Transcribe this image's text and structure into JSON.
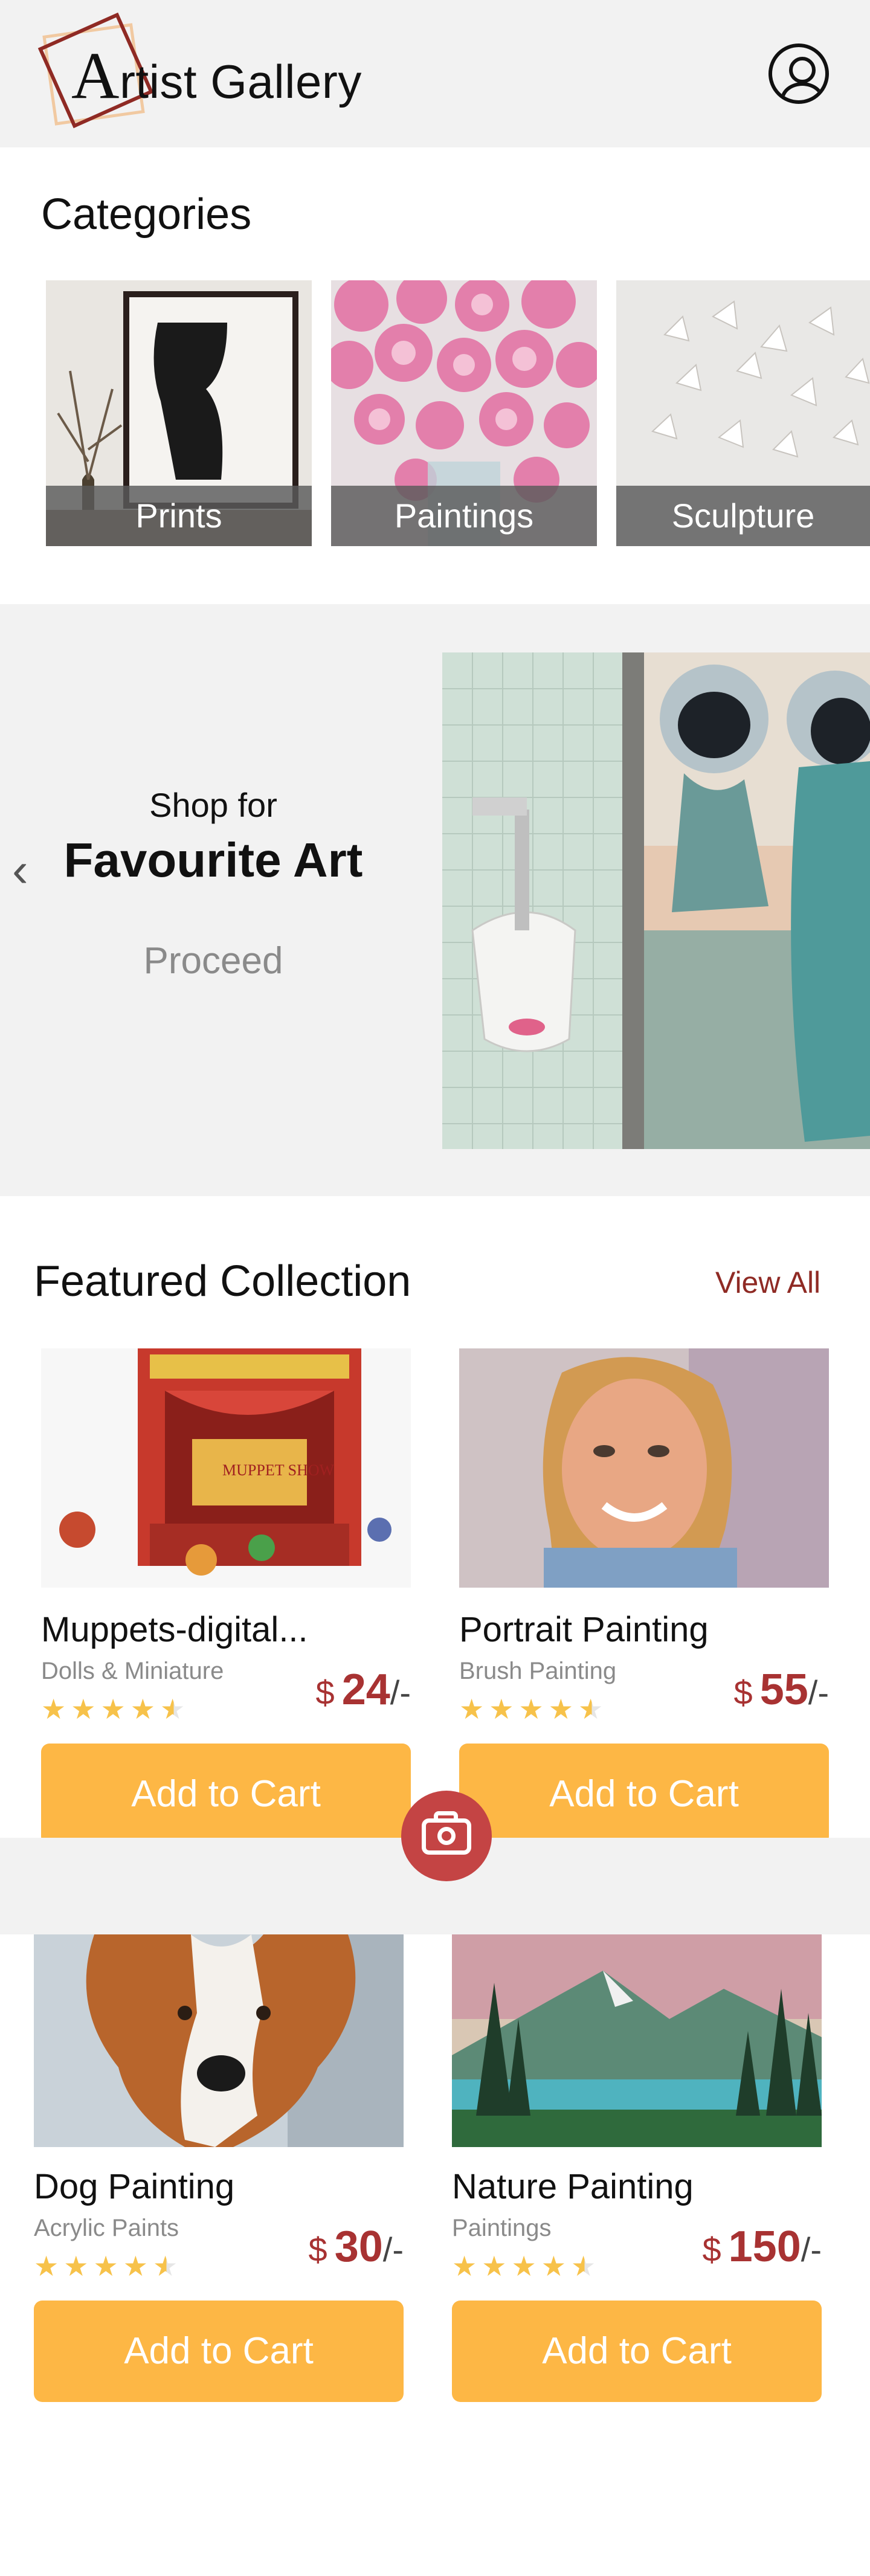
{
  "header": {
    "logo_initial": "A",
    "logo_rest": "rtist Gallery",
    "profile_icon": "user-circle-icon"
  },
  "categories": {
    "title": "Categories",
    "items": [
      {
        "label": "Prints"
      },
      {
        "label": "Paintings"
      },
      {
        "label": "Sculpture"
      }
    ]
  },
  "promo": {
    "prev_icon": "chevron-left-icon",
    "subtitle": "Shop for",
    "title": "Favourite Art",
    "cta": "Proceed"
  },
  "featured": {
    "title": "Featured Collection",
    "view_all": "View All",
    "products": [
      {
        "name": "Muppets-digital...",
        "category": "Dolls & Miniature",
        "currency": "$",
        "price": "24",
        "suffix": "/-",
        "rating": 4.5,
        "button": "Add to Cart"
      },
      {
        "name": "Portrait Painting",
        "category": "Brush Painting",
        "currency": "$",
        "price": "55",
        "suffix": "/-",
        "rating": 4.5,
        "button": "Add to Cart"
      },
      {
        "name": "Dog Painting",
        "category": "Acrylic Paints",
        "currency": "$",
        "price": "30",
        "suffix": "/-",
        "rating": 4.5,
        "button": "Add to Cart"
      },
      {
        "name": "Nature Painting",
        "category": "Paintings",
        "currency": "$",
        "price": "150",
        "suffix": "/-",
        "rating": 4.5,
        "button": "Add to Cart"
      }
    ]
  },
  "floating": {
    "camera_icon": "camera-icon"
  },
  "colors": {
    "accent": "#fdb745",
    "brand": "#8f2a24",
    "price": "#a83232",
    "camera": "#c44444"
  }
}
